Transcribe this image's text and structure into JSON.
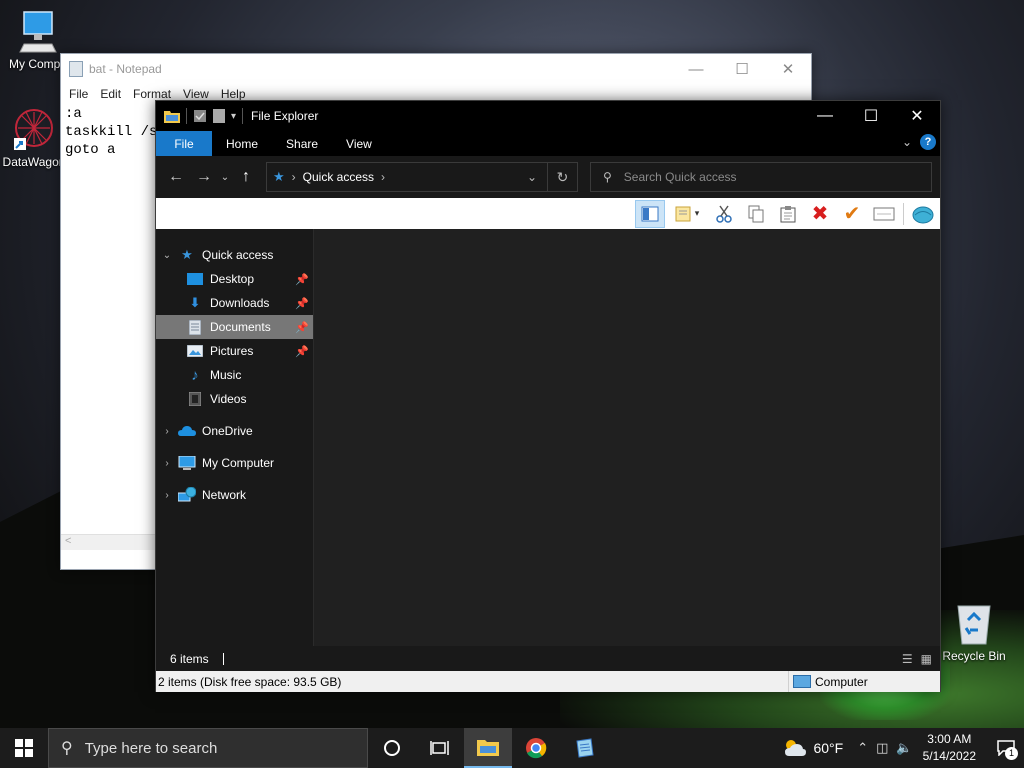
{
  "desktop": {
    "icons": [
      {
        "label": "My Compu",
        "icon": "computer-icon"
      },
      {
        "label": "DataWagon",
        "icon": "datawagon-icon"
      },
      {
        "label": "Recycle Bin",
        "icon": "recycle-bin-icon"
      }
    ]
  },
  "notepad": {
    "title": "bat - Notepad",
    "menu": [
      "File",
      "Edit",
      "Format",
      "View",
      "Help"
    ],
    "text": ":a\ntaskkill /s\ngoto a",
    "scroll_arrow": "<"
  },
  "explorer": {
    "title": "File Explorer",
    "tabs": [
      "File",
      "Home",
      "Share",
      "View"
    ],
    "address": {
      "location": "Quick access"
    },
    "search_placeholder": "Search Quick access",
    "nav": [
      {
        "label": "Quick access",
        "icon": "star-icon",
        "level": 0,
        "expanded": true
      },
      {
        "label": "Desktop",
        "icon": "desktop-folder-icon",
        "level": 1,
        "pinned": true
      },
      {
        "label": "Downloads",
        "icon": "downloads-icon",
        "level": 1,
        "pinned": true
      },
      {
        "label": "Documents",
        "icon": "documents-icon",
        "level": 1,
        "pinned": true,
        "selected": true
      },
      {
        "label": "Pictures",
        "icon": "pictures-icon",
        "level": 1,
        "pinned": true
      },
      {
        "label": "Music",
        "icon": "music-icon",
        "level": 1
      },
      {
        "label": "Videos",
        "icon": "videos-icon",
        "level": 1
      },
      {
        "label": "OneDrive",
        "icon": "onedrive-icon",
        "level": 0
      },
      {
        "label": "My Computer",
        "icon": "computer-icon",
        "level": 0
      },
      {
        "label": "Network",
        "icon": "network-icon",
        "level": 0
      }
    ],
    "status": {
      "items": "6 items"
    },
    "info": {
      "summary": "2 items (Disk free space: 93.5 GB)",
      "zone": "Computer"
    }
  },
  "taskbar": {
    "search_placeholder": "Type here to search",
    "weather": "60°F",
    "time": "3:00 AM",
    "date": "5/14/2022",
    "notification_count": "1"
  },
  "colors": {
    "accent": "#1979ca",
    "selected": "#777777"
  }
}
